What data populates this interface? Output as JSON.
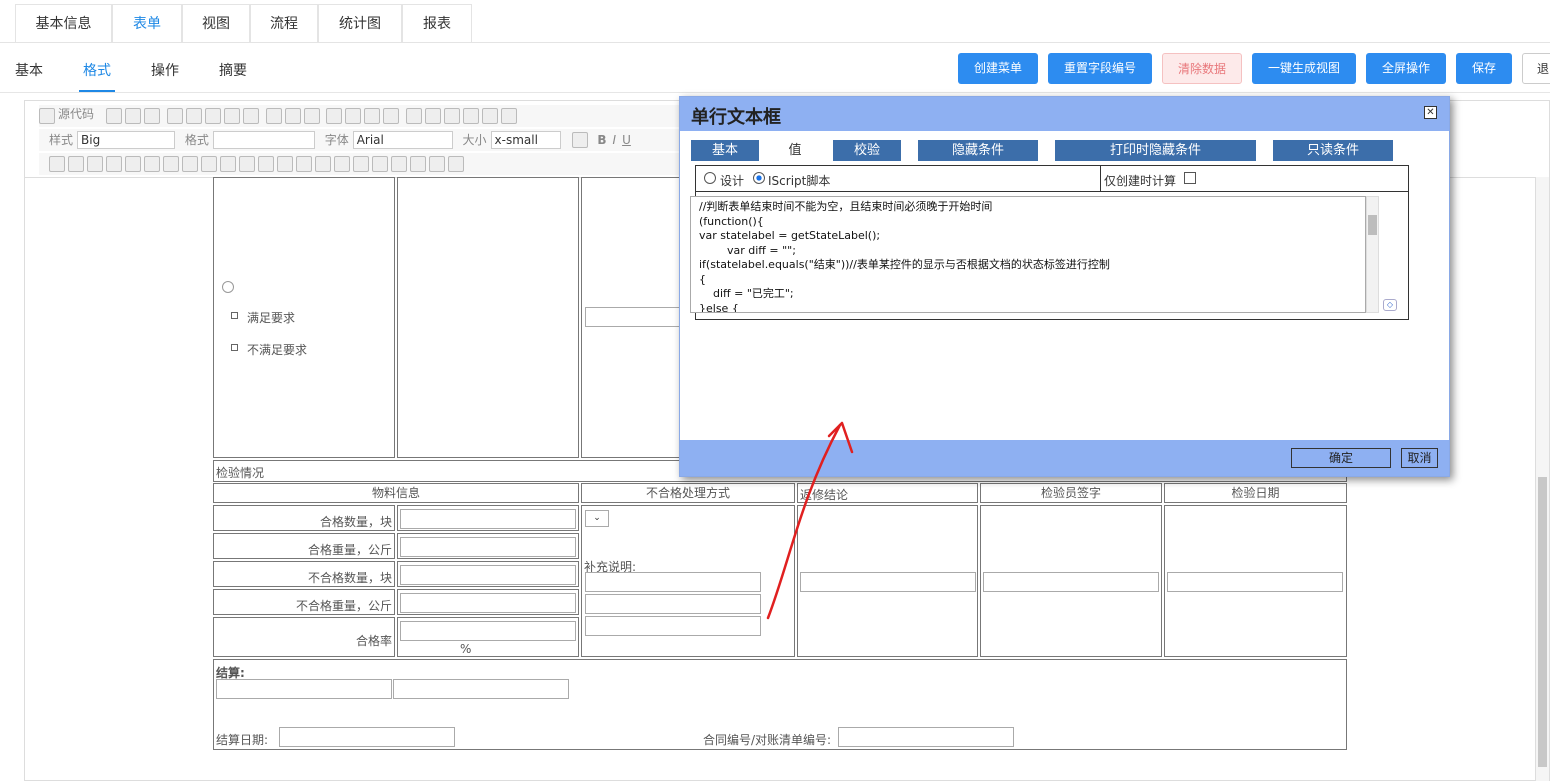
{
  "top_tabs": [
    "基本信息",
    "表单",
    "视图",
    "流程",
    "统计图",
    "报表"
  ],
  "sub_tabs": [
    "基本",
    "格式",
    "操作",
    "摘要"
  ],
  "buttons": {
    "create_menu": "创建菜单",
    "reset_field": "重置字段编号",
    "clear_data": "清除数据",
    "gen_view": "一键生成视图",
    "fullscreen": "全屏操作",
    "save": "保存",
    "exit": "退"
  },
  "toolbar": {
    "source": "源代码",
    "style_label": "样式",
    "style_value": "Big",
    "format_label": "格式",
    "font_label": "字体",
    "font_value": "Arial",
    "size_label": "大小",
    "size_value": "x-small"
  },
  "form": {
    "opt_meet": "满足要求",
    "opt_not_meet": "不满足要求",
    "section_inspection": "检验情况",
    "col_material": "物料信息",
    "col_disposal": "不合格处理方式",
    "col_return": "返修结论",
    "col_inspector": "检验员签字",
    "col_date": "检验日期",
    "row_qty_ok": "合格数量，块",
    "row_wt_ok": "合格重量，公斤",
    "row_qty_ng": "不合格数量，块",
    "row_wt_ng": "不合格重量，公斤",
    "row_rate": "合格率",
    "percent": "%",
    "supplement": "补充说明:",
    "settle": "结算:",
    "settle_date": "结算日期:",
    "contract_no": "合同编号/对账清单编号:"
  },
  "modal": {
    "title": "单行文本框",
    "close": "☒",
    "tabs": [
      "基本",
      "值",
      "校验",
      "隐藏条件",
      "打印时隐藏条件",
      "只读条件"
    ],
    "radio_design": "设计",
    "radio_script": "IScript脚本",
    "create_only": "仅创建时计算",
    "code_lines": [
      "//判断表单结束时间不能为空，且结束时间必须晚于开始时间",
      "(function(){",
      "var statelabel = getStateLabel();",
      "        var diff = \"\";",
      "if(statelabel.equals(\"结束\"))//表单某控件的显示与否根据文档的状态标签进行控制",
      "{",
      "    diff = \"已完工\";",
      "}else {"
    ],
    "ok": "确定",
    "cancel": "取消"
  }
}
